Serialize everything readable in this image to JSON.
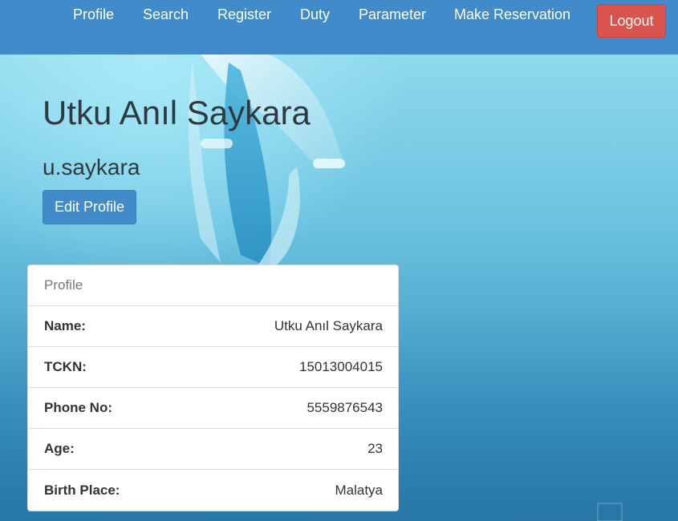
{
  "nav": {
    "items": [
      {
        "label": "Profile"
      },
      {
        "label": "Search"
      },
      {
        "label": "Register"
      },
      {
        "label": "Duty"
      },
      {
        "label": "Parameter"
      },
      {
        "label": "Make Reservation"
      }
    ],
    "logout_label": "Logout"
  },
  "header": {
    "full_name": "Utku Anıl Saykara",
    "username": "u.saykara",
    "edit_label": "Edit Profile"
  },
  "profile_panel": {
    "heading": "Profile",
    "rows": [
      {
        "label": "Name:",
        "value": "Utku Anıl Saykara"
      },
      {
        "label": "TCKN:",
        "value": "15013004015"
      },
      {
        "label": "Phone No:",
        "value": "5559876543"
      },
      {
        "label": "Age:",
        "value": "23"
      },
      {
        "label": "Birth Place:",
        "value": "Malatya"
      }
    ]
  },
  "colors": {
    "navbar": "#428bca",
    "logout": "#d9534f",
    "primary": "#428bca"
  }
}
